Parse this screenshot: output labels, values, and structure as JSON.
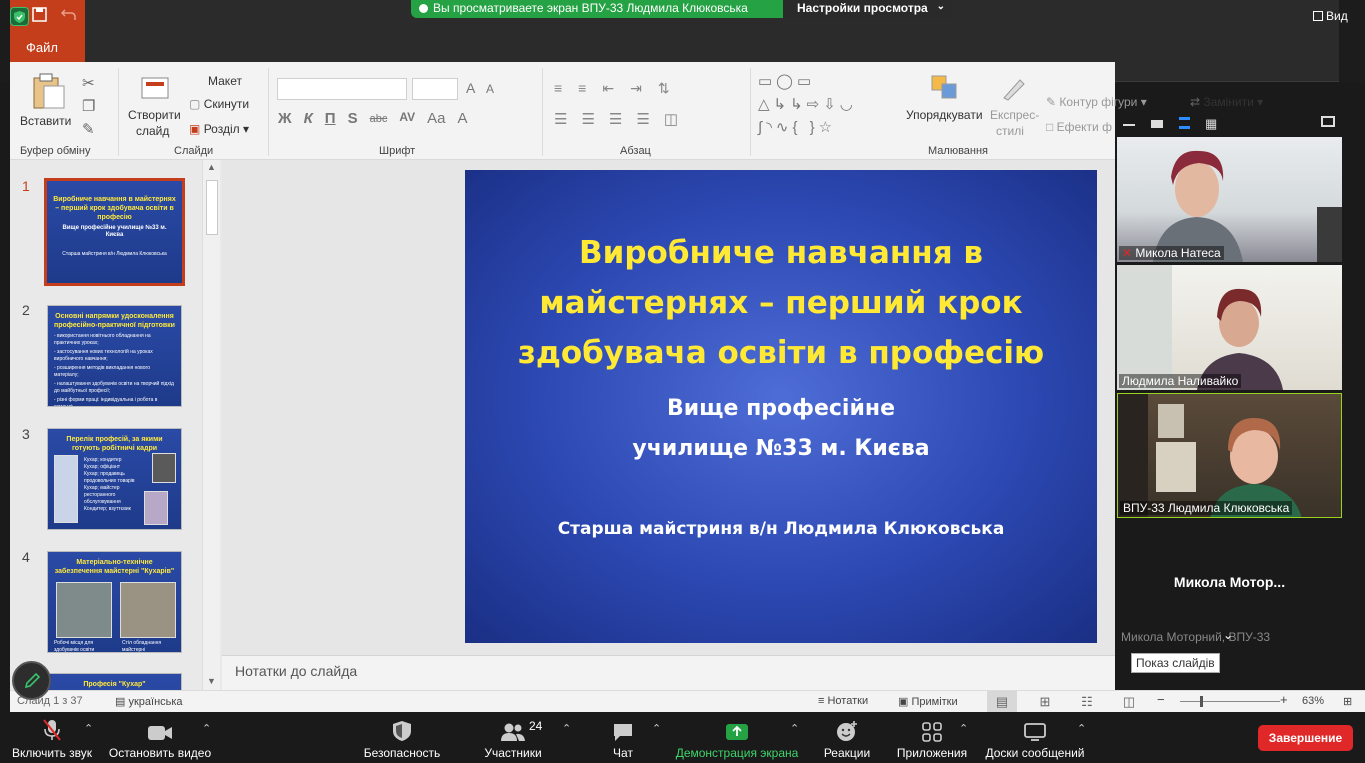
{
  "zoom": {
    "share_banner": "Вы просматриваете экран ВПУ-33 Людмила Клюковська",
    "view_settings": "Настройки просмотра",
    "view_menu": "Вид",
    "toolbar": {
      "mic": "Включить звук",
      "video": "Остановить видео",
      "security": "Безопасность",
      "participants": "Участники",
      "participants_count": "24",
      "chat": "Чат",
      "share": "Демонстрация экрана",
      "reactions": "Реакции",
      "apps": "Приложения",
      "whiteboards": "Доски сообщений",
      "end": "Завершение"
    },
    "participants": [
      {
        "name": "Микола Натеса",
        "muted": true
      },
      {
        "name": "Людмила Наливайко",
        "muted": false
      },
      {
        "name": "ВПУ-33 Людмила Клюковська",
        "muted": false
      }
    ],
    "big_name": "Микола  Мотор...",
    "hidden_name": "Микола Моторний, ВПУ-33",
    "tooltip": "Показ слайдів"
  },
  "ppt": {
    "file_tab": "Файл",
    "ribbon": {
      "paste": "Вставити",
      "clipboard_group": "Буфер обміну",
      "new_slide_1": "Створити",
      "new_slide_2": "слайд",
      "layout": "Макет",
      "reset": "Скинути",
      "section": "Розділ",
      "slides_group": "Слайди",
      "font_group": "Шрифт",
      "paragraph_group": "Абзац",
      "arrange": "Упорядкувати",
      "quick_styles_1": "Експрес-",
      "quick_styles_2": "стилі",
      "shape_outline": "Контур фігури",
      "shape_effects": "Ефекти ф",
      "drawing_group": "Малювання",
      "replace": "Замінити",
      "font_buttons": [
        "Ж",
        "К",
        "П",
        "S",
        "abc",
        "AV",
        "Aa",
        "A"
      ]
    },
    "slides": [
      {
        "num": "1",
        "title": "Виробниче навчання в майстернях – перший крок здобувача освіти в професію",
        "sub": "Вище професійне училище №33  м. Києва",
        "foot": "Старша майстриня в/н  Людмила Клюковська"
      },
      {
        "num": "2",
        "title": "Основні напрямки удосконалення професійно-практичної підготовки",
        "lines": [
          "- використання новітнього обладнання на практичних уроках;",
          "- застосування нових технологій на уроках виробничого навчання;",
          "- розширення методів викладання нового матеріалу;",
          "- налаштування здобувачів освіти на творчий підхід до майбутньої професії;",
          "- різні форми праці: індивідуальна і робота в команді;"
        ]
      },
      {
        "num": "3",
        "title": "Перелік професій, за якими готують робітничі кадри",
        "lines": [
          "Кухар; кондитер",
          "Кухар; офіціант",
          "Кухар; продавець продовольчих товарів",
          "Кухар; майстер ресторанного обслуговування",
          "Кондитер; взуттєвик"
        ]
      },
      {
        "num": "4",
        "title": "Матеріально-технічне забезпечення майстерні \"Кухарів\"",
        "caps": [
          "Робочі місця для здобувачів освіти",
          "Стіл обладнання майстерні"
        ]
      },
      {
        "num": "5",
        "title": "Професія \"Кухар\""
      }
    ],
    "main_slide": {
      "title_lines": [
        "Виробниче навчання в",
        "майстернях – перший крок",
        "здобувача освіти в професію"
      ],
      "sub_lines": [
        "Вище професійне",
        "училище №33  м. Києва"
      ],
      "author": "Старша майстриня в/н  Людмила Клюковська"
    },
    "notes_placeholder": "Нотатки до слайда",
    "status": {
      "slide_count": "Слайд 1 з 37",
      "language": "українська",
      "notes": "Нотатки",
      "comments": "Примітки",
      "zoom": "63%"
    }
  },
  "colors": {
    "accent_ppt": "#c43e1c",
    "slide_title": "#ffe935",
    "share_green": "#25a244",
    "end_red": "#e02828"
  }
}
